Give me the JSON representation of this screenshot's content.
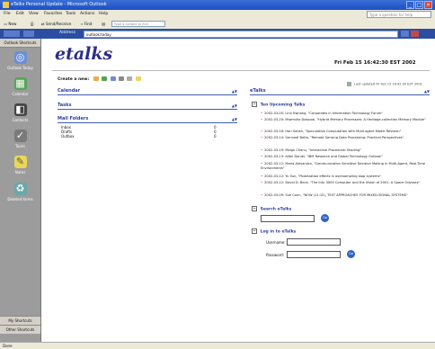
{
  "window": {
    "title": "eTalks Personal Update - Microsoft Outlook"
  },
  "menu": [
    "File",
    "Edit",
    "View",
    "Favorites",
    "Tools",
    "Actions",
    "Help"
  ],
  "help_box": "Type a question for help",
  "toolbar": {
    "new": "New",
    "send_receive": "Send/Receive",
    "find": "Find",
    "find_placeholder": "Type a contact to find"
  },
  "address": {
    "label": "Address",
    "value": "outlook:today"
  },
  "tooltip": "outlook:",
  "shortcuts": {
    "header": "Outlook Shortcuts",
    "items": [
      "Outlook Today",
      "Calendar",
      "Contacts",
      "Tasks",
      "Notes",
      "Deleted Items"
    ],
    "bottom": [
      "My Shortcuts",
      "Other Shortcuts"
    ]
  },
  "page": {
    "logo": "etalks",
    "datetime": "Fri Feb 15 16:42:30 EST 2002",
    "create_label": "Create a new:",
    "panels": {
      "calendar": "Calendar",
      "tasks": "Tasks",
      "mail": "Mail Folders",
      "etalks": "eTalks"
    },
    "mail_folders": [
      {
        "name": "Inbox",
        "count": "0"
      },
      {
        "name": "Drafts",
        "count": "0"
      },
      {
        "name": "Outbox",
        "count": "0"
      }
    ],
    "last_updated": "Last updated Fri Feb 15 16:42:30 EST 2002",
    "upcoming_title": "Ten Upcoming Talks",
    "talks": [
      "2002-03-05: Linli Hwnong, \"Corporates in Information Technology Forum\"",
      "2002-03-20: Miwmuko Dokpuai, \"Hybrid Memory Processors: A Heritage-collection Memory Module\"",
      "2002-03-18: Hari Satish, \"Speculative Computation with Multi-agent Model Revision\"",
      "2002-03-14: Gennadi Beita, \"Remote Sensing Data Processing: Practical Perspectives\"",
      "2002-03-19: Meigh Chanu, \"Interactive Procedural Shading\"",
      "2002-03-13: Allen Daniel, \"IBM Research and Global Technology Outlook\"",
      "2002-03-12: Maria Alexandra, \"Communication Sensitive Decision Making in Multi-Agent, Real-Time Environments\"",
      "2002-03-12: Yu Sun, \"Polarization effects in oversampling loop systems\"",
      "2002-03-12: David D. Beck, \"The Intu 3000 Computer and the Vision of 2001: A Space Odyssey\"",
      "2002-03-09: Sue Conn, \"NOW (11:15), TEST APPROACHES FOR MIXED-SIGNAL SYSTEMS\""
    ],
    "search_title": "Search eTalks",
    "login_title": "Log in to eTalks",
    "username_label": "Username:",
    "password_label": "Password:",
    "go": "Go"
  },
  "status": "Done"
}
